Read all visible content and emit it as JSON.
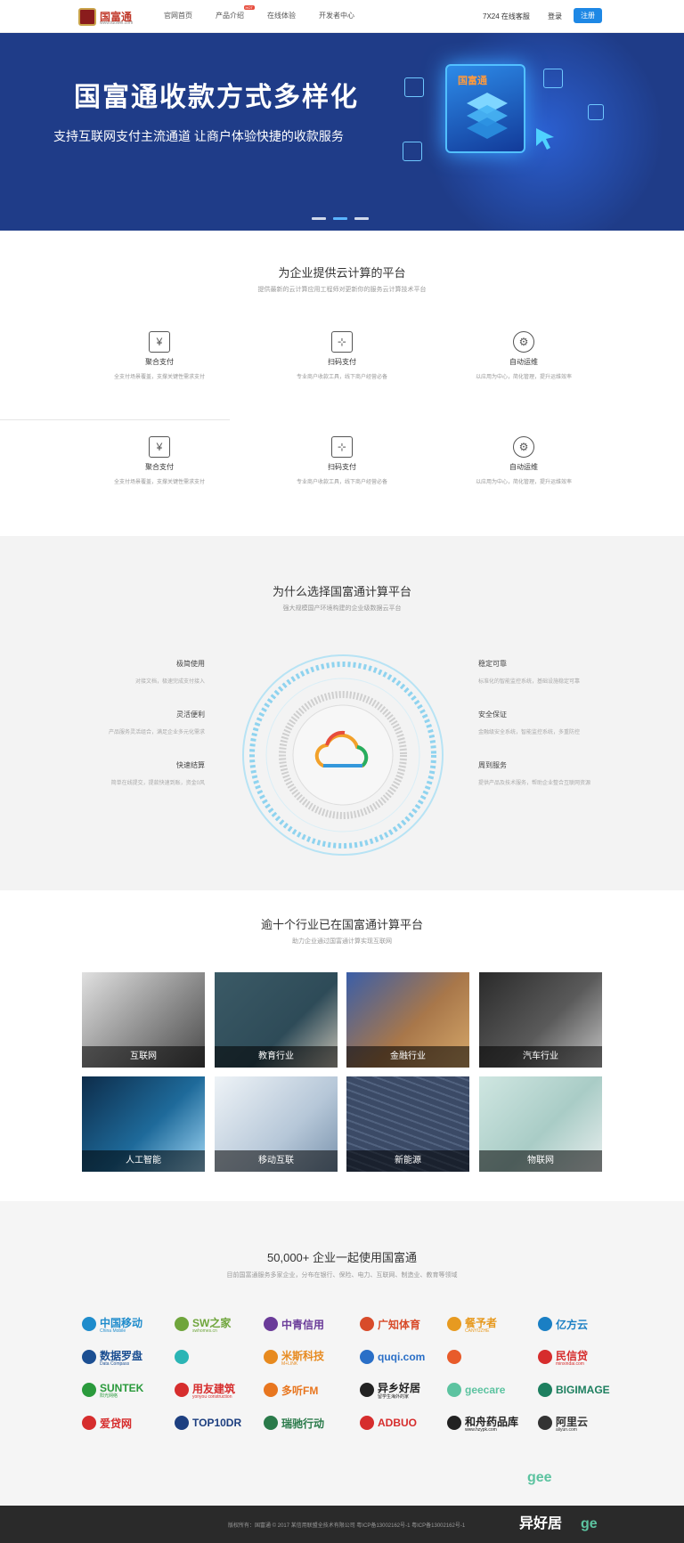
{
  "header": {
    "logo_text": "国富通",
    "logo_sub": "www.tuowei.com",
    "nav": [
      {
        "label": "官网首页"
      },
      {
        "label": "产品介绍",
        "badge": "HOT"
      },
      {
        "label": "在线体验"
      },
      {
        "label": "开发者中心"
      }
    ],
    "hotline": "7X24 在线客服",
    "login": "登录",
    "register": "注册"
  },
  "banner": {
    "title": "国富通收款方式多样化",
    "subtitle": "支持互联网支付主流通道    让商户体验快捷的收款服务",
    "cube_label": "国富通",
    "dots": 3,
    "active_dot": 1
  },
  "platform": {
    "title": "为企业提供云计算的平台",
    "subtitle": "提供最新的云计算应用工程师对更新你的服务云计算技术平台",
    "features": [
      {
        "icon": "yen-chat-icon",
        "glyph": "¥",
        "title": "聚合支付",
        "desc": "全支付场景覆盖，支撑关键性需求支付"
      },
      {
        "icon": "qr-network-icon",
        "glyph": "⊹",
        "title": "扫码支付",
        "desc": "专业商户收款工具，线下商户经营必备"
      },
      {
        "icon": "gear-icon",
        "glyph": "⚙",
        "title": "自动运维",
        "desc": "以应用为中心，简化管理，提升运维效率"
      },
      {
        "icon": "yen-chat-icon",
        "glyph": "¥",
        "title": "聚合支付",
        "desc": "全支付场景覆盖，支撑关键性需求支付"
      },
      {
        "icon": "qr-network-icon",
        "glyph": "⊹",
        "title": "扫码支付",
        "desc": "专业商户收款工具，线下商户经营必备"
      },
      {
        "icon": "gear-icon",
        "glyph": "⚙",
        "title": "自动运维",
        "desc": "以应用为中心，简化管理，提升运维效率"
      }
    ]
  },
  "why": {
    "title": "为什么选择国富通计算平台",
    "subtitle": "强大规模国产环境构建的企业级数据云平台",
    "left": [
      {
        "title": "极简使用",
        "desc": "对接文档，极速完成支付接入"
      },
      {
        "title": "灵活便利",
        "desc": "产品服务灵活组合，满足企业多元化需求"
      },
      {
        "title": "快速结算",
        "desc": "简单在线提交，提款快速到账，资金0风"
      }
    ],
    "right": [
      {
        "title": "稳定可靠",
        "desc": "标准化的智能监控系统，基础设施稳定可靠"
      },
      {
        "title": "安全保证",
        "desc": "金融级安全系统，智能监控系统，多重防控"
      },
      {
        "title": "周到服务",
        "desc": "提供产品及技术服务，帮助企业整合互联网资源"
      }
    ]
  },
  "industries": {
    "title": "逾十个行业已在国富通计算平台",
    "subtitle": "助力企业通过国富通计算实现互联网",
    "items": [
      {
        "label": "互联网",
        "color": "#8d8d8d"
      },
      {
        "label": "教育行业",
        "color": "#2e4b58"
      },
      {
        "label": "金融行业",
        "color": "#a8774a"
      },
      {
        "label": "汽车行业",
        "color": "#5a5a5a"
      },
      {
        "label": "人工智能",
        "color": "#1e6a9a"
      },
      {
        "label": "移动互联",
        "color": "#b6c7d8"
      },
      {
        "label": "新能源",
        "color": "#3b4a66"
      },
      {
        "label": "物联网",
        "color": "#a9ccc6"
      }
    ]
  },
  "partners": {
    "title": "50,000+ 企业一起使用国富通",
    "subtitle": "目前国富通服务多家企业，分布在银行、保险、电力、互联网、制造业、教育等领域",
    "logos": [
      {
        "name": "中国移动",
        "sub": "China Mobile",
        "color": "#1f8ccc"
      },
      {
        "name": "SW之家",
        "sub": "swhomes.cn",
        "color": "#6fa53c"
      },
      {
        "name": "中青信用",
        "sub": "",
        "color": "#6a3b99"
      },
      {
        "name": "广知体育",
        "sub": "",
        "color": "#d84b2a"
      },
      {
        "name": "餐予者",
        "sub": "CANYUZHE",
        "color": "#e79a20"
      },
      {
        "name": "亿方云",
        "sub": "",
        "color": "#1a7fc4"
      },
      {
        "name": "数据罗盘",
        "sub": "Data Compass",
        "color": "#1c4f92"
      },
      {
        "name": "",
        "sub": "",
        "color": "#2bb5b5"
      },
      {
        "name": "米斯科技",
        "sub": "M+LINK",
        "color": "#e78a1f"
      },
      {
        "name": "quqi.com",
        "sub": "",
        "color": "#2a6fc7"
      },
      {
        "name": "",
        "sub": "",
        "color": "#e85b2a"
      },
      {
        "name": "民信贷",
        "sub": "minxindai.com",
        "color": "#d62d2d"
      },
      {
        "name": "SUNTEK",
        "sub": "阳光网络",
        "color": "#2a9a3c"
      },
      {
        "name": "用友建筑",
        "sub": "yonyou construction",
        "color": "#d62d2d"
      },
      {
        "name": "多听FM",
        "sub": "",
        "color": "#e8761f"
      },
      {
        "name": "异乡好居",
        "sub": "留学生海外的家",
        "color": "#222222"
      },
      {
        "name": "geecare",
        "sub": "",
        "color": "#5cc3a0"
      },
      {
        "name": "BIGIMAGE",
        "sub": "",
        "color": "#1d7f5f"
      },
      {
        "name": "爱贷网",
        "sub": "",
        "color": "#d62d2d"
      },
      {
        "name": "TOP10DR",
        "sub": "",
        "color": "#1d3f80"
      },
      {
        "name": "瑞驰行动",
        "sub": "",
        "color": "#2a7a4a"
      },
      {
        "name": "ADBUO",
        "sub": "",
        "color": "#d62d2d"
      },
      {
        "name": "和舟药品库",
        "sub": "www.hzypk.com",
        "color": "#222222"
      },
      {
        "name": "阿里云",
        "sub": "aliyun.com",
        "color": "#333333"
      }
    ]
  },
  "footer": {
    "text": "版权所有：国富通 © 2017 某信用联盟全技术有限公司 粤ICP备13002162号-1    粤ICP备13002162号-1"
  },
  "colors": {
    "brand_blue": "#1f3c88",
    "accent": "#1e88e5",
    "section_gray": "#f3f3f3"
  }
}
